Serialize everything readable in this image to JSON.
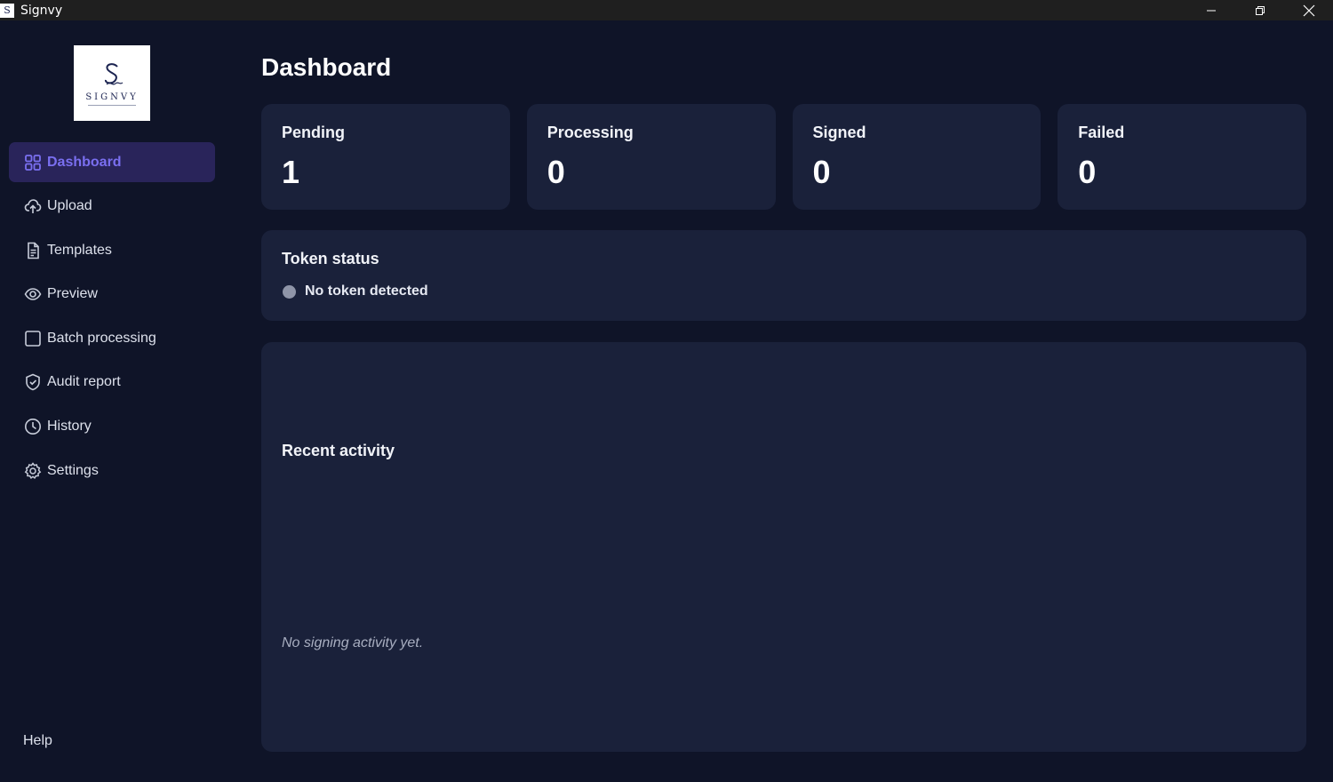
{
  "window": {
    "title": "Signvy",
    "controls": [
      "minimize",
      "restore",
      "close"
    ]
  },
  "sidebar": {
    "logo": {
      "wordmark": "SIGNVY",
      "monogram": "S"
    },
    "items": [
      {
        "label": "Dashboard",
        "icon": "grid-icon",
        "active": true
      },
      {
        "label": "Upload",
        "icon": "cloud-upload-icon",
        "active": false
      },
      {
        "label": "Templates",
        "icon": "document-icon",
        "active": false
      },
      {
        "label": "Preview",
        "icon": "eye-icon",
        "active": false
      },
      {
        "label": "Batch processing",
        "icon": "square-icon",
        "active": false
      },
      {
        "label": "Audit report",
        "icon": "shield-check-icon",
        "active": false
      },
      {
        "label": "History",
        "icon": "clock-icon",
        "active": false
      },
      {
        "label": "Settings",
        "icon": "gear-icon",
        "active": false
      }
    ],
    "help_label": "Help"
  },
  "main": {
    "title": "Dashboard",
    "stats": [
      {
        "label": "Pending",
        "value": "1"
      },
      {
        "label": "Processing",
        "value": "0"
      },
      {
        "label": "Signed",
        "value": "0"
      },
      {
        "label": "Failed",
        "value": "0"
      }
    ],
    "token": {
      "title": "Token status",
      "status": "No token detected",
      "status_color": "#8f95a8"
    },
    "activity": {
      "title": "Recent activity",
      "empty_text": "No signing activity yet."
    }
  },
  "colors": {
    "background": "#0f1428",
    "card": "#1a213a",
    "active_bg": "#29245a",
    "accent": "#7a6ff0"
  }
}
